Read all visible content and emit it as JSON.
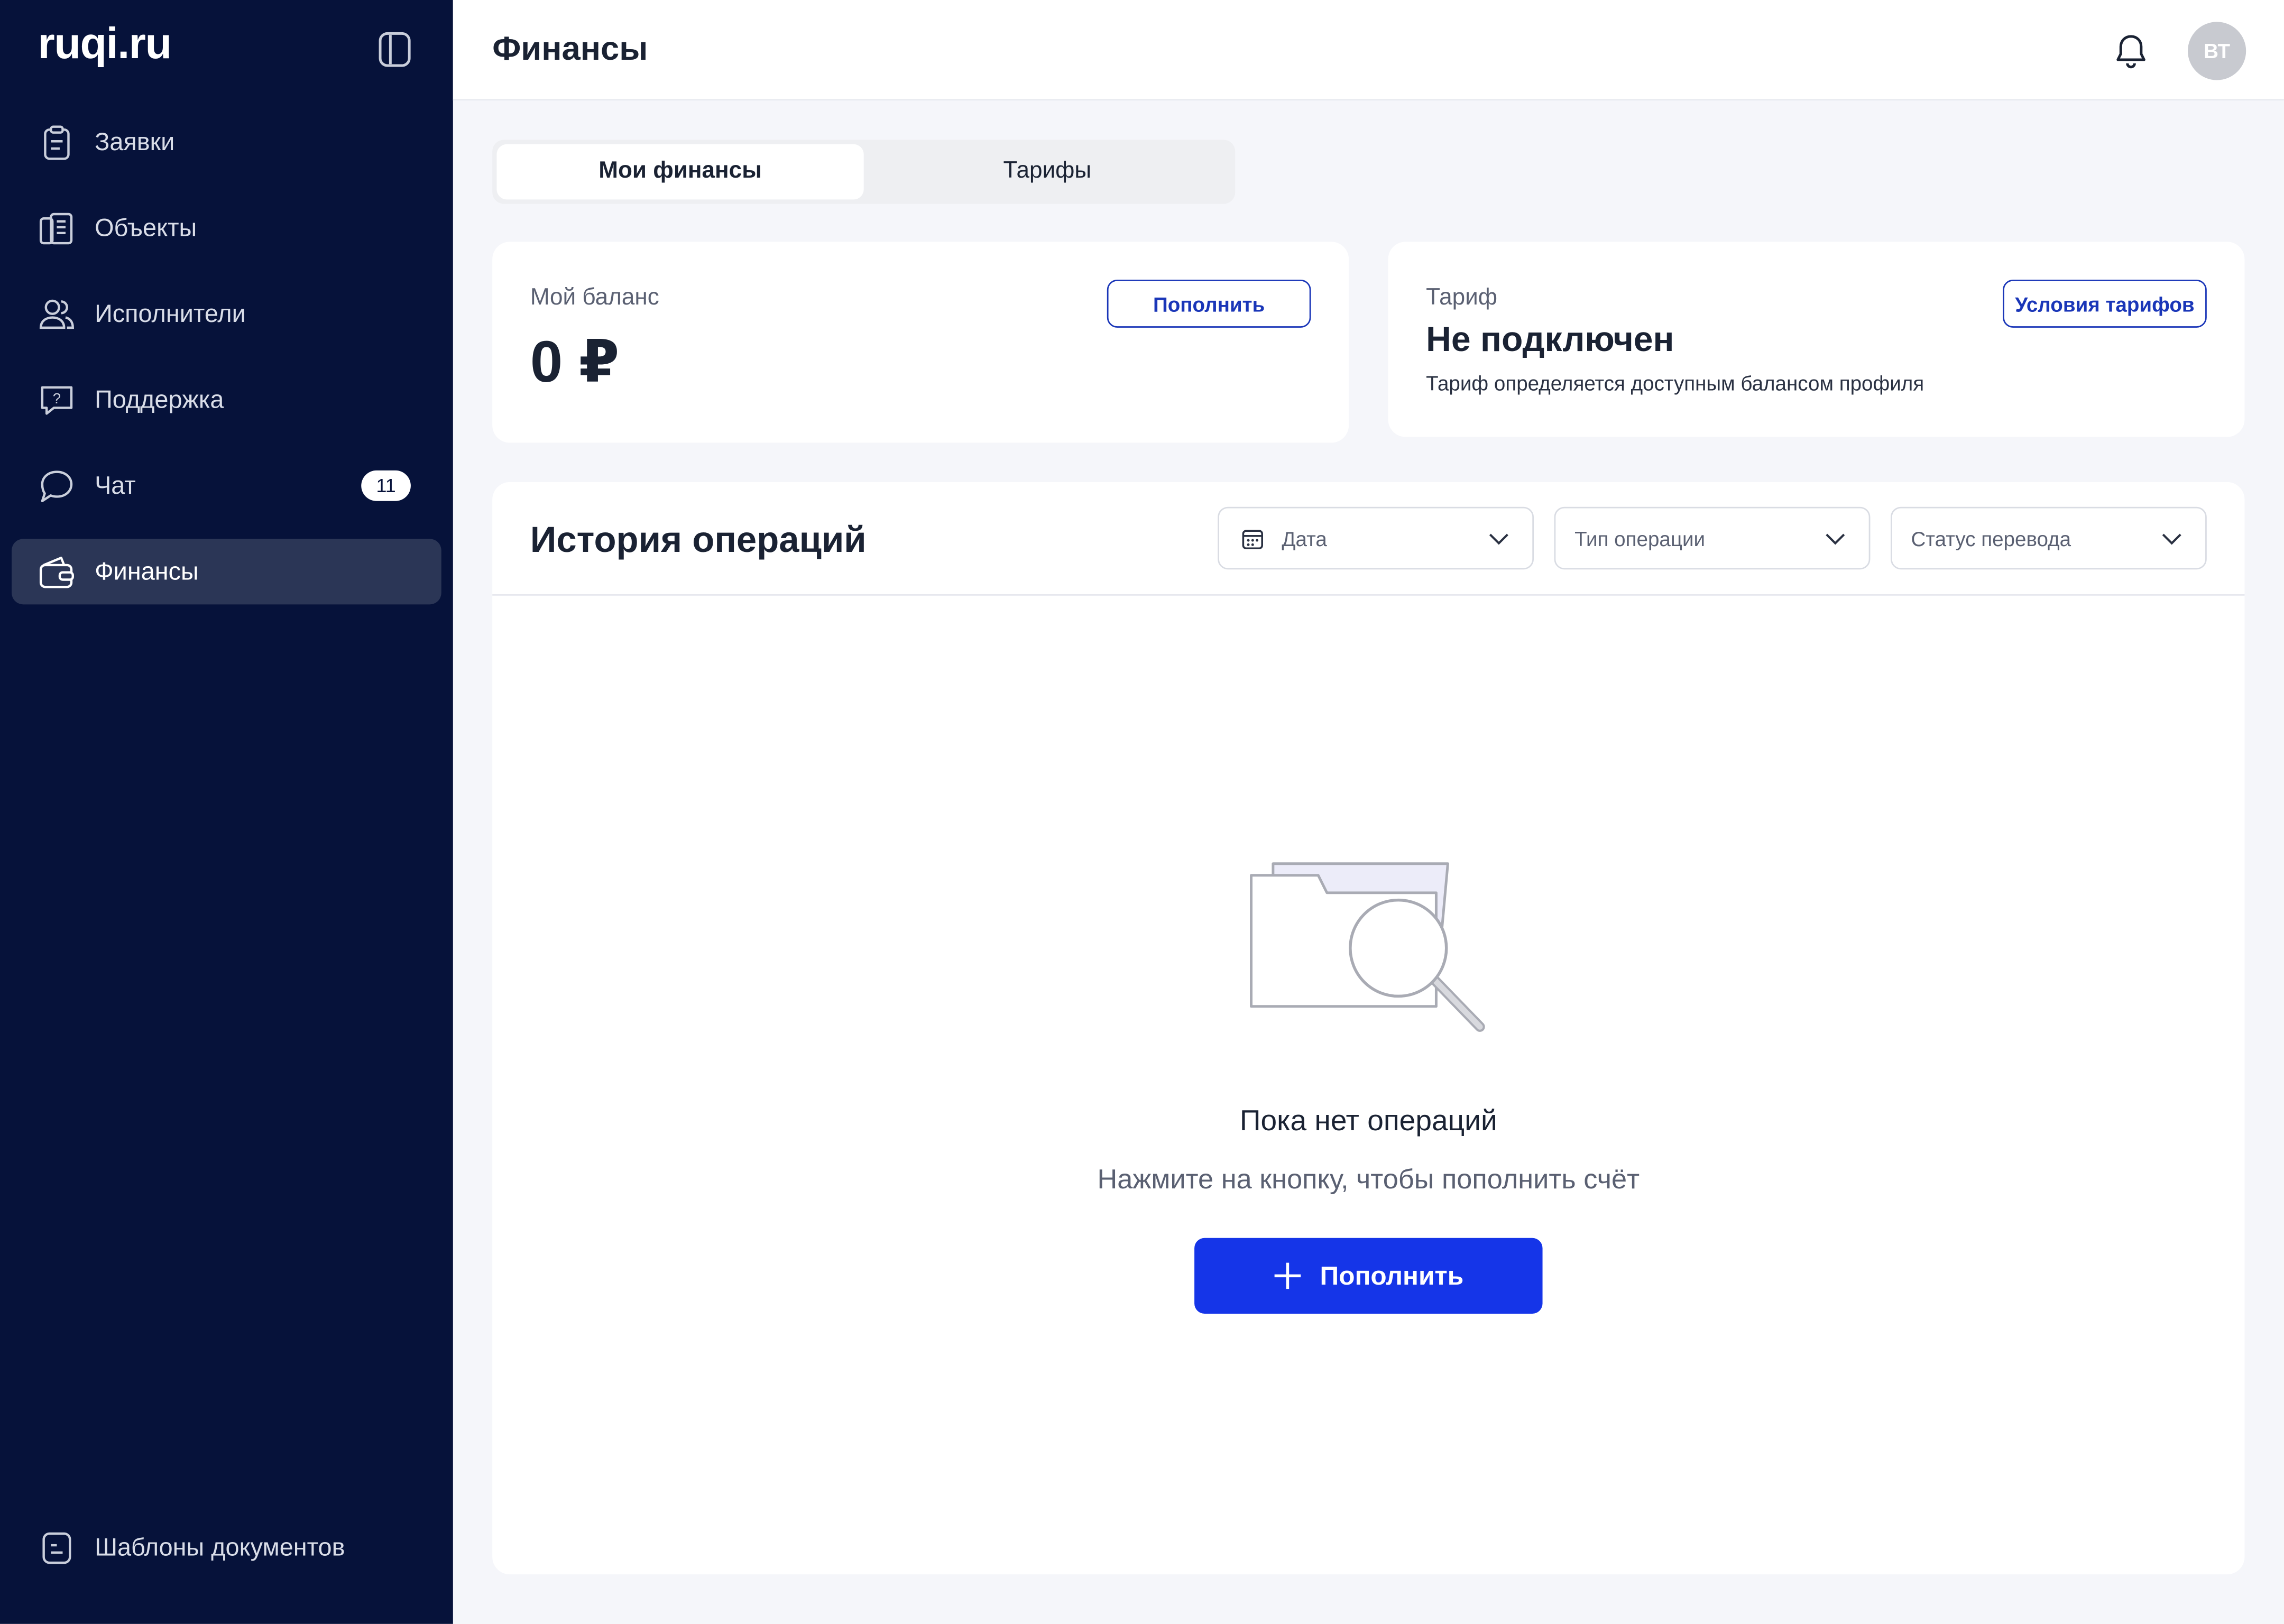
{
  "app": {
    "logo": "ruqi.ru"
  },
  "sidebar": {
    "items": [
      {
        "label": "Заявки",
        "icon": "clipboard-icon"
      },
      {
        "label": "Объекты",
        "icon": "buildings-icon"
      },
      {
        "label": "Исполнители",
        "icon": "users-icon"
      },
      {
        "label": "Поддержка",
        "icon": "help-chat-icon"
      },
      {
        "label": "Чат",
        "icon": "chat-icon",
        "badge": "11"
      },
      {
        "label": "Финансы",
        "icon": "wallet-icon",
        "active": true
      }
    ],
    "bottom": {
      "label": "Шаблоны документов",
      "icon": "document-icon"
    }
  },
  "header": {
    "title": "Финансы",
    "avatar_initials": "ВТ"
  },
  "tabs": [
    {
      "label": "Мои финансы",
      "active": true
    },
    {
      "label": "Тарифы",
      "active": false
    }
  ],
  "balance": {
    "label": "Мой баланс",
    "value": "0 ₽",
    "topup_label": "Пополнить"
  },
  "tariff": {
    "label": "Тариф",
    "status": "Не подключен",
    "description": "Тариф определяется доступным балансом профиля",
    "conditions_label": "Условия тарифов"
  },
  "history": {
    "title": "История операций",
    "filters": {
      "date": "Дата",
      "operation_type": "Тип операции",
      "transfer_status": "Статус перевода"
    },
    "empty": {
      "title": "Пока нет операций",
      "subtitle": "Нажмите на кнопку, чтобы пополнить счёт",
      "button_label": "Пополнить"
    }
  },
  "colors": {
    "sidebar_bg": "#06123a",
    "sidebar_active": "#2b3656",
    "primary": "#1535e8",
    "outline": "#1a36b8",
    "page_bg": "#f5f6fa"
  }
}
